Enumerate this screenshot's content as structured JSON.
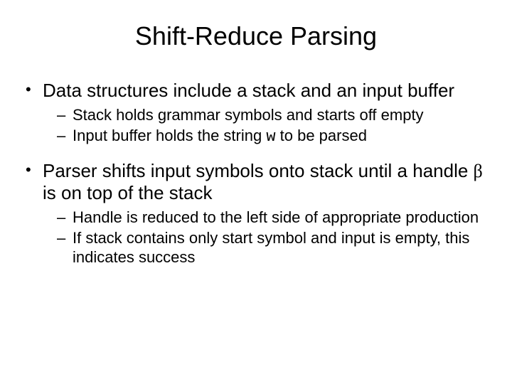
{
  "title": "Shift-Reduce Parsing",
  "bullets": [
    {
      "text": "Data structures include a stack and an input buffer",
      "sub": [
        {
          "text": "Stack holds grammar symbols and starts off empty"
        },
        {
          "pre": "Input buffer holds the string ",
          "sym": "w",
          "post": " to be parsed",
          "symClass": "mono"
        }
      ]
    },
    {
      "pre": "Parser shifts input symbols onto stack until a handle ",
      "sym": "β",
      "post": "  is on top of the stack",
      "symClass": "sym",
      "sub": [
        {
          "text": "Handle is reduced to the left side of appropriate production"
        },
        {
          "text": "If stack contains only start symbol and input is empty, this indicates success"
        }
      ]
    }
  ]
}
